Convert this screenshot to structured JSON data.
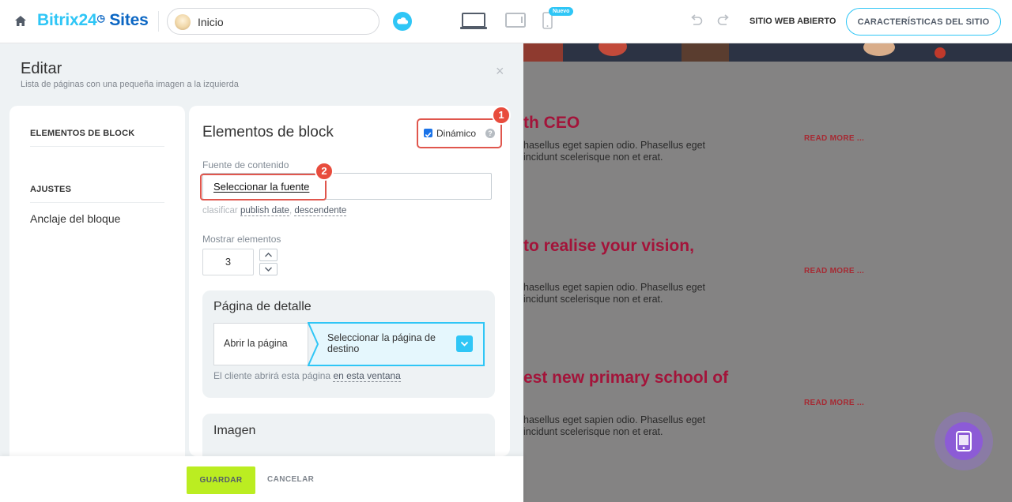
{
  "header": {
    "brand_part1": "Bitrix24",
    "brand_clock": "◷",
    "brand_part2": "Sites",
    "page_selector": "Inicio",
    "new_badge": "Nuevo",
    "open_site": "SITIO WEB ABIERTO",
    "site_features": "CARACTERÍSTICAS DEL SITIO",
    "icons": [
      "home-icon",
      "cloud-icon",
      "laptop-icon",
      "tablet-icon",
      "phone-icon",
      "undo-icon",
      "redo-icon"
    ]
  },
  "panel": {
    "title": "Editar",
    "subtitle": "Lista de páginas con una pequeña imagen a la izquierda",
    "close": "×",
    "nav": {
      "section1": "ELEMENTOS DE BLOCK",
      "section2": "AJUSTES",
      "anchor": "Anclaje del bloque"
    },
    "content": {
      "title": "Elementos de block",
      "dynamic_label": "Dinámico",
      "dynamic_checked": true,
      "help": "?",
      "badge1": "1",
      "badge2": "2",
      "source_label": "Fuente de contenido",
      "source_button": "Seleccionar la fuente",
      "sort_key": "clasificar",
      "sort_field": "publish date",
      "sort_sep": ",",
      "sort_order": "descendente",
      "show_label": "Mostrar elementos",
      "show_value": "3",
      "detail": {
        "title": "Página de detalle",
        "open_page": "Abrir la página",
        "select_target": "Seleccionar la página de destino",
        "note_prefix": "El cliente abrirá esta página",
        "note_link": "en esta ventana"
      },
      "image_title": "Imagen"
    },
    "footer": {
      "save": "GUARDAR",
      "cancel": "CANCELAR"
    }
  },
  "preview": {
    "items": [
      {
        "title": "th CEO",
        "text": "hasellus eget sapien odio. Phasellus eget incidunt scelerisque non et erat.",
        "more": "READ MORE ..."
      },
      {
        "title": "to realise your vision,",
        "text": "hasellus eget sapien odio. Phasellus eget incidunt scelerisque non et erat.",
        "more": "READ MORE ..."
      },
      {
        "title": "est new primary school of",
        "text": "hasellus eget sapien odio. Phasellus eget incidunt scelerisque non et erat.",
        "more": "READ MORE ..."
      }
    ]
  },
  "colors": {
    "accent_blue": "#2fc6f6",
    "brand_dark_blue": "#0b66c3",
    "annotation_red": "#e0564d",
    "save_green": "#bbed21",
    "preview_title": "#a3143a"
  }
}
